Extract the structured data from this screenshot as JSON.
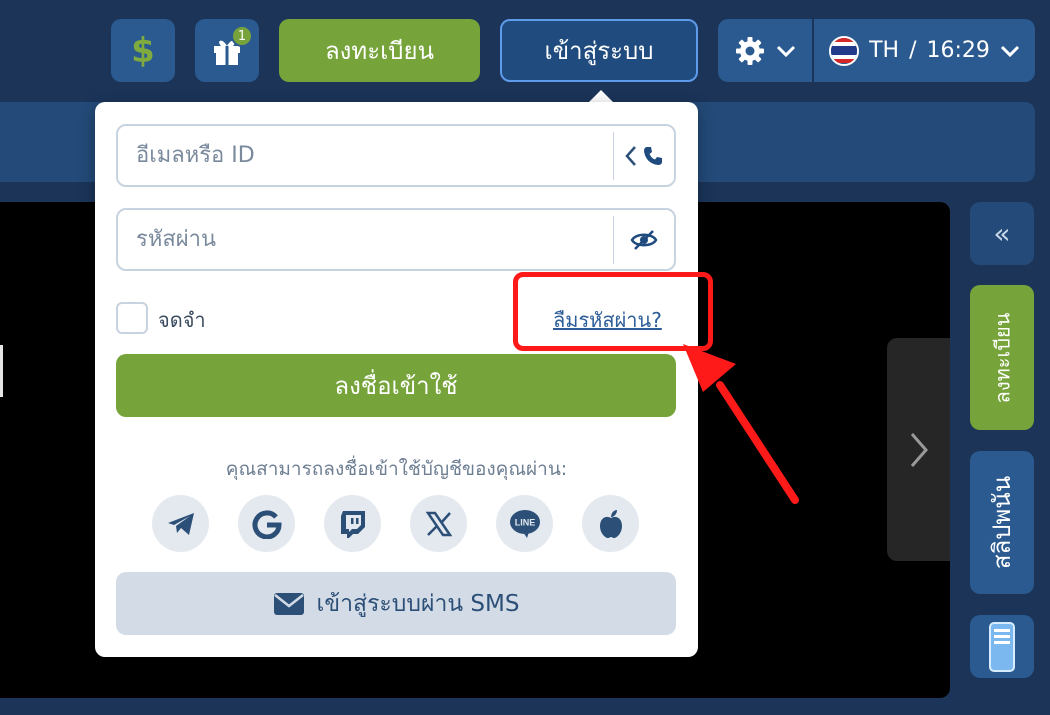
{
  "header": {
    "wallet_icon_text": "$",
    "gift_badge": "1",
    "register_label": "ลงทะเบียน",
    "login_label": "เข้าสู่ระบบ",
    "language": "TH",
    "separator": "/",
    "time": "16:29"
  },
  "login_popup": {
    "email_placeholder": "อีเมลหรือ ID",
    "password_placeholder": "รหัสผ่าน",
    "remember_label": "จดจำ",
    "forgot_label": "ลืมรหัสผ่าน?",
    "submit_label": "ลงชื่อเข้าใช้",
    "social_prompt": "คุณสามารถลงชื่อเข้าใช้บัญชีของคุณผ่าน:",
    "social_icons": [
      "telegram-icon",
      "google-icon",
      "twitch-icon",
      "x-icon",
      "line-icon",
      "apple-icon"
    ],
    "line_icon_text": "LINE",
    "sms_label": "เข้าสู่ระบบผ่าน SMS"
  },
  "sidebar": {
    "collapse_icon": "«",
    "register_label": "ลงทะเบียน",
    "betslip_label": "สลิปพนัน"
  },
  "colors": {
    "background": "#1b3458",
    "primary_button": "#76a43a",
    "panel": "#2a5a8f",
    "highlight": "#ff1a1a"
  }
}
